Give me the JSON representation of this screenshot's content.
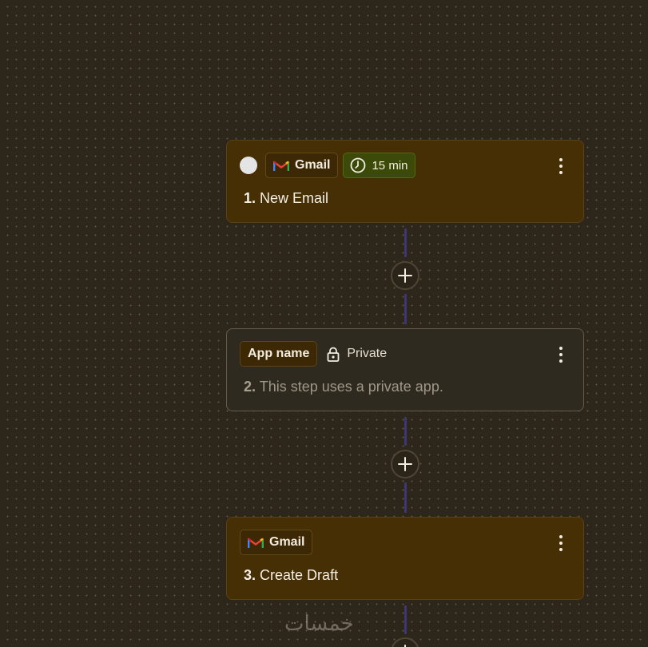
{
  "steps": [
    {
      "number": "1.",
      "title": "New Email",
      "app_label": "Gmail",
      "badge": "15 min"
    },
    {
      "number": "2.",
      "title": "This step uses a private app.",
      "app_label": "App name",
      "privacy_label": "Private"
    },
    {
      "number": "3.",
      "title": "Create Draft",
      "app_label": "Gmail"
    }
  ],
  "icons": {
    "app": "gmail-icon",
    "time": "clock-icon",
    "privacy": "lock-icon",
    "menu": "more-vertical-icon",
    "add": "plus-icon",
    "status": "status-dot"
  },
  "colors": {
    "canvas": "#2c261b",
    "card_active": "#462e05",
    "card_private": "#2e2a20",
    "connector": "#3f3678",
    "time_badge": "#3b4a08"
  },
  "watermark": "خمسات"
}
